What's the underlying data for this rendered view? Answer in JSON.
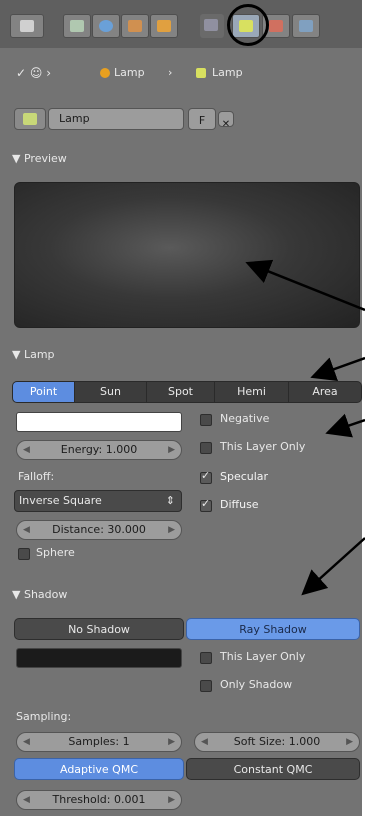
{
  "header": {
    "tabs": [
      {
        "icon": "render-layers-icon",
        "color": "#d0d0d0"
      },
      {
        "icon": "scene-icon",
        "color": "#b0c8b0"
      },
      {
        "icon": "world-icon",
        "color": "#6aa0d8"
      },
      {
        "icon": "object-icon",
        "color": "#d09050"
      },
      {
        "icon": "constraints-icon",
        "color": "#e0a040"
      },
      {
        "icon": "modifiers-icon",
        "color": "#9090a0"
      },
      {
        "icon": "lamp-data-icon",
        "color": "#d8e060"
      },
      {
        "icon": "texture-icon",
        "color": "#d07060"
      },
      {
        "icon": "physics-icon",
        "color": "#80a0c0"
      }
    ]
  },
  "context": {
    "crumb1": "Lamp",
    "crumb2": "Lamp"
  },
  "datablock": {
    "name": "Lamp",
    "fake_user": "F"
  },
  "preview": {
    "title": "Preview"
  },
  "lamp": {
    "title": "Lamp",
    "types": [
      "Point",
      "Sun",
      "Spot",
      "Hemi",
      "Area"
    ],
    "active_type": "Point",
    "energy": "Energy: 1.000",
    "falloff_label": "Falloff:",
    "falloff_value": "Inverse Square",
    "distance": "Distance: 30.000",
    "sphere": "Sphere",
    "negative": "Negative",
    "this_layer_only": "This Layer Only",
    "specular": "Specular",
    "diffuse": "Diffuse"
  },
  "shadow": {
    "title": "Shadow",
    "no_shadow": "No Shadow",
    "ray_shadow": "Ray Shadow",
    "this_layer_only": "This Layer Only",
    "only_shadow": "Only Shadow",
    "sampling_label": "Sampling:",
    "samples": "Samples: 1",
    "soft_size": "Soft Size: 1.000",
    "adaptive": "Adaptive QMC",
    "constant": "Constant QMC",
    "threshold": "Threshold: 0.001"
  },
  "colors": {
    "panel": "#737373",
    "accent": "#5d8de0"
  }
}
